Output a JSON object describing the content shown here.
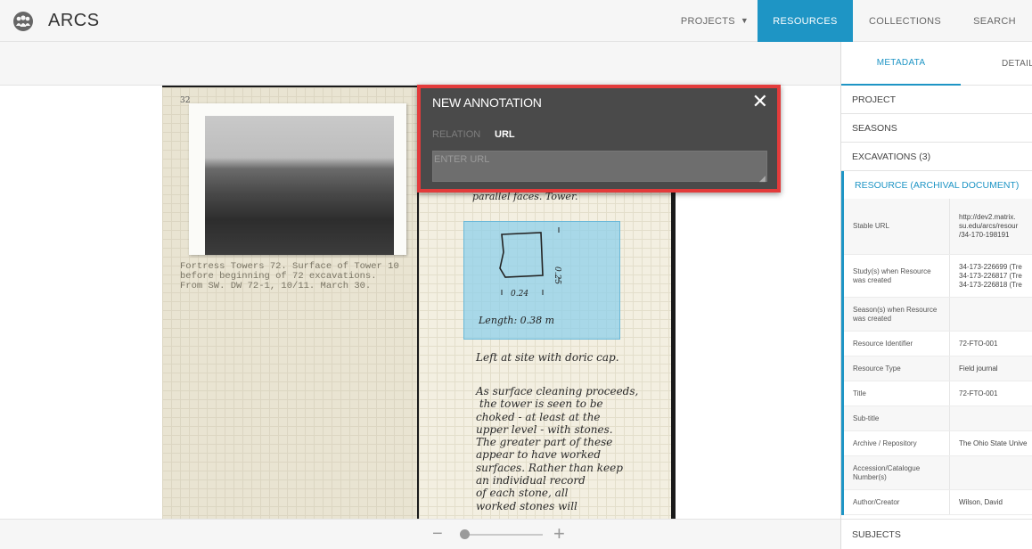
{
  "app": {
    "title": "ARCS"
  },
  "nav": {
    "projects": "PROJECTS",
    "resources": "RESOURCES",
    "collections": "COLLECTIONS",
    "search": "SEARCH"
  },
  "colors": {
    "accent": "#1e95c5",
    "highlight_border": "#e33b3b",
    "dialog_bg": "#4a4a4a"
  },
  "document": {
    "page_number": "32",
    "photo_caption": "Fortress Towers 72. Surface of Tower 10\nbefore beginning of 72 excavations.\nFrom SW. DW 72-1, 10/11. March 30.",
    "top_text": "parallel faces. Tower.",
    "sketch_width": "0.24",
    "sketch_height": "0.25",
    "sketch_length": "Length: 0.38 m",
    "left_note": "Left at site with doric cap.",
    "paragraph": "As surface cleaning proceeds,\n the tower is seen to be\nchoked - at least at the\nupper level - with stones.\nThe greater part of these\nappear to have worked\nsurfaces. Rather than keep\nan individual record\nof each stone, all\nworked stones will"
  },
  "annotation": {
    "title": "NEW ANNOTATION",
    "tab_relation": "RELATION",
    "tab_url": "URL",
    "url_placeholder": "ENTER URL",
    "close_icon": "close-icon"
  },
  "zoom": {
    "minus": "−",
    "plus": "+",
    "level": 0.02
  },
  "sidebar": {
    "tab_metadata": "METADATA",
    "tab_details": "DETAILS",
    "sections": {
      "project": "PROJECT",
      "seasons": "SEASONS",
      "excavations": "EXCAVATIONS (3)",
      "resource": "RESOURCE (ARCHIVAL DOCUMENT)",
      "subjects": "SUBJECTS"
    },
    "meta": [
      {
        "label": "Stable URL",
        "value": "http://dev2.matrix.\nsu.edu/arcs/resour\n/34-170-198191"
      },
      {
        "label": "Study(s) when Resource was created",
        "value": "34-173-226699 (Tre\n34-173-226817 (Tre\n34-173-226818 (Tre"
      },
      {
        "label": "Season(s) when Resource was created",
        "value": ""
      },
      {
        "label": "Resource Identifier",
        "value": "72-FTO-001"
      },
      {
        "label": "Resource Type",
        "value": "Field journal"
      },
      {
        "label": "Title",
        "value": "72-FTO-001"
      },
      {
        "label": "Sub-title",
        "value": ""
      },
      {
        "label": "Archive / Repository",
        "value": "The Ohio State Unive"
      },
      {
        "label": "Accession/Catalogue Number(s)",
        "value": ""
      },
      {
        "label": "Author/Creator",
        "value": "Wilson, David"
      }
    ]
  }
}
